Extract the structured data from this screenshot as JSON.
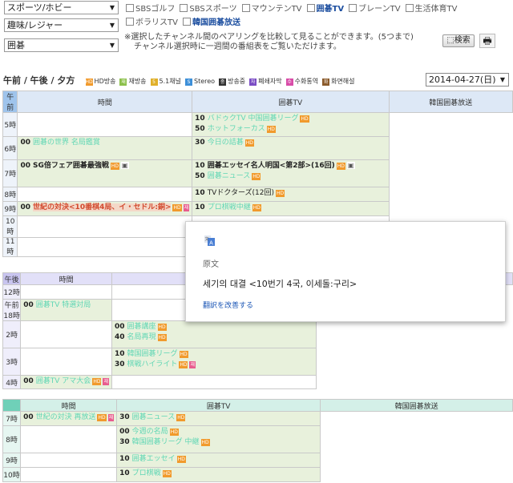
{
  "filters": {
    "select1": "スポーツ/ホビー",
    "select2": "趣味/レジャー",
    "select3": "囲碁",
    "channels_row1": [
      {
        "label": "SBSゴルフ",
        "bold": false
      },
      {
        "label": "SBSスポーツ",
        "bold": false
      },
      {
        "label": "マウンテンTV",
        "bold": false
      },
      {
        "label": "囲碁TV",
        "bold": true
      },
      {
        "label": "ブレーンTV",
        "bold": false
      },
      {
        "label": "生活体育TV",
        "bold": false
      }
    ],
    "channels_row2": [
      {
        "label": "ボラリスTV",
        "bold": false
      },
      {
        "label": "韓国囲碁放送",
        "bold": true
      }
    ],
    "notice_line1": "※選択したチャンネル間のペアリングを比較して見ることができます。(5つまで)",
    "notice_line2": "チャンネル選択時に一週間の番組表をご覧いただけます。",
    "search_label": "検索",
    "print_icon": "print-icon"
  },
  "legend": {
    "periods": "午前 / 午後 / 夕方",
    "items": [
      {
        "icon": "HD",
        "label": "HD방송",
        "color": "#f19a2c"
      },
      {
        "icon": "재",
        "label": "재방송",
        "color": "#8cc04b"
      },
      {
        "icon": "5",
        "label": "5.1채널",
        "color": "#e0b02a"
      },
      {
        "icon": "S",
        "label": "Stereo",
        "color": "#3d8fd8"
      },
      {
        "icon": "중",
        "label": "방송중",
        "color": "#333333"
      },
      {
        "icon": "자",
        "label": "폐쇄자막",
        "color": "#7a4cc4"
      },
      {
        "icon": "수",
        "label": "수화통역",
        "color": "#d84ca8"
      },
      {
        "icon": "화",
        "label": "화면해설",
        "color": "#8a5a2a"
      }
    ],
    "date": "2014-04-27(日)"
  },
  "grid": {
    "col_time": "時間",
    "col_ch1": "囲碁TV",
    "col_ch2": "韓国囲碁放送",
    "band_am": "午前",
    "band_pm": "午後",
    "am_rows": [
      {
        "hour": "5時",
        "ch2": [
          {
            "min": "10",
            "title": "バドゥクTV 中国囲碁リーグ",
            "style": "t-faded",
            "badges": [
              "hd"
            ]
          },
          {
            "min": "50",
            "title": "ホットフォーカス",
            "style": "t-faded",
            "badges": [
              "hd"
            ]
          }
        ]
      },
      {
        "hour": "6時",
        "ch1": [
          {
            "min": "00",
            "title": "囲碁の世界 名局鑑賞",
            "style": "t-faded",
            "badges": []
          }
        ],
        "ch2": [
          {
            "min": "30",
            "title": "今日の詰碁",
            "style": "t-faded",
            "badges": [
              "hd"
            ]
          }
        ]
      },
      {
        "hour": "7時",
        "ch1": [
          {
            "min": "00",
            "title": "SG倍フェア囲碁最強戦",
            "style": "t-dark",
            "badges": [
              "hd",
              "cap"
            ]
          }
        ],
        "ch2": [
          {
            "min": "10",
            "title": "囲碁エッセイ名人明国<第2部>(16回)",
            "style": "t-dark",
            "badges": [
              "hd",
              "cap"
            ]
          },
          {
            "min": "50",
            "title": "囲碁ニュース",
            "style": "t-faded",
            "badges": [
              "hd"
            ]
          }
        ]
      },
      {
        "hour": "8時",
        "ch2": [
          {
            "min": "10",
            "title": "TVドクターズ(12回)",
            "style": "t-plain",
            "badges": [
              "hd"
            ]
          }
        ]
      },
      {
        "hour": "9時",
        "ch1": [
          {
            "min": "00",
            "title": "世紀の対決<10番棋4局、イ・セドル:銅>",
            "style": "t-hl",
            "badges": [
              "hd",
              "se"
            ]
          }
        ],
        "ch2": [
          {
            "min": "10",
            "title": "プロ棋戦中継",
            "style": "t-faded",
            "badges": [
              "hd"
            ]
          }
        ]
      },
      {
        "hour": "10時"
      },
      {
        "hour": "11時"
      }
    ],
    "pm_rows": [
      {
        "hour": "12時"
      },
      {
        "hour": "午前18時",
        "ch1": [
          {
            "min": "00",
            "title": "囲碁TV 特選対局",
            "style": "t-faded",
            "badges": []
          }
        ]
      },
      {
        "hour": "2時",
        "ch2": [
          {
            "min": "00",
            "title": "囲碁講座",
            "style": "t-faded",
            "badges": [
              "hd"
            ]
          },
          {
            "min": "40",
            "title": "名局再現",
            "style": "t-faded",
            "badges": [
              "hd"
            ]
          }
        ]
      },
      {
        "hour": "3時",
        "ch2": [
          {
            "min": "10",
            "title": "韓国囲碁リーグ",
            "style": "t-faded",
            "badges": [
              "hd"
            ]
          },
          {
            "min": "30",
            "title": "棋戦ハイライト",
            "style": "t-faded",
            "badges": [
              "hd",
              "se"
            ]
          }
        ]
      },
      {
        "hour": "4時",
        "ch1": [
          {
            "min": "00",
            "title": "囲碁TV アマ大会",
            "style": "t-faded",
            "badges": [
              "hd",
              "se"
            ]
          }
        ]
      }
    ],
    "ev_rows": [
      {
        "hour": "7時",
        "ch1": [
          {
            "min": "00",
            "title": "世紀の対決 再放送",
            "style": "t-faded",
            "badges": [
              "hd",
              "se"
            ]
          }
        ],
        "ch2": [
          {
            "min": "30",
            "title": "囲碁ニュース",
            "style": "t-faded",
            "badges": [
              "hd"
            ]
          }
        ]
      },
      {
        "hour": "8時",
        "ch2": [
          {
            "min": "00",
            "title": "今週の名局",
            "style": "t-faded",
            "badges": [
              "hd"
            ]
          },
          {
            "min": "30",
            "title": "韓国囲碁リーグ 中継",
            "style": "t-faded",
            "badges": [
              "hd"
            ]
          }
        ]
      },
      {
        "hour": "9時",
        "ch2": [
          {
            "min": "10",
            "title": "囲碁エッセイ",
            "style": "t-faded",
            "badges": [
              "hd"
            ]
          }
        ]
      },
      {
        "hour": "10時",
        "ch2": [
          {
            "min": "10",
            "title": "プロ棋戦",
            "style": "t-faded",
            "badges": [
              "hd"
            ]
          }
        ]
      }
    ]
  },
  "popup": {
    "icon": "google-translate-icon",
    "label": "原文",
    "original": "세기의 대결 <10번기 4국, 이세돌:구리>",
    "improve": "翻訳を改善する"
  }
}
